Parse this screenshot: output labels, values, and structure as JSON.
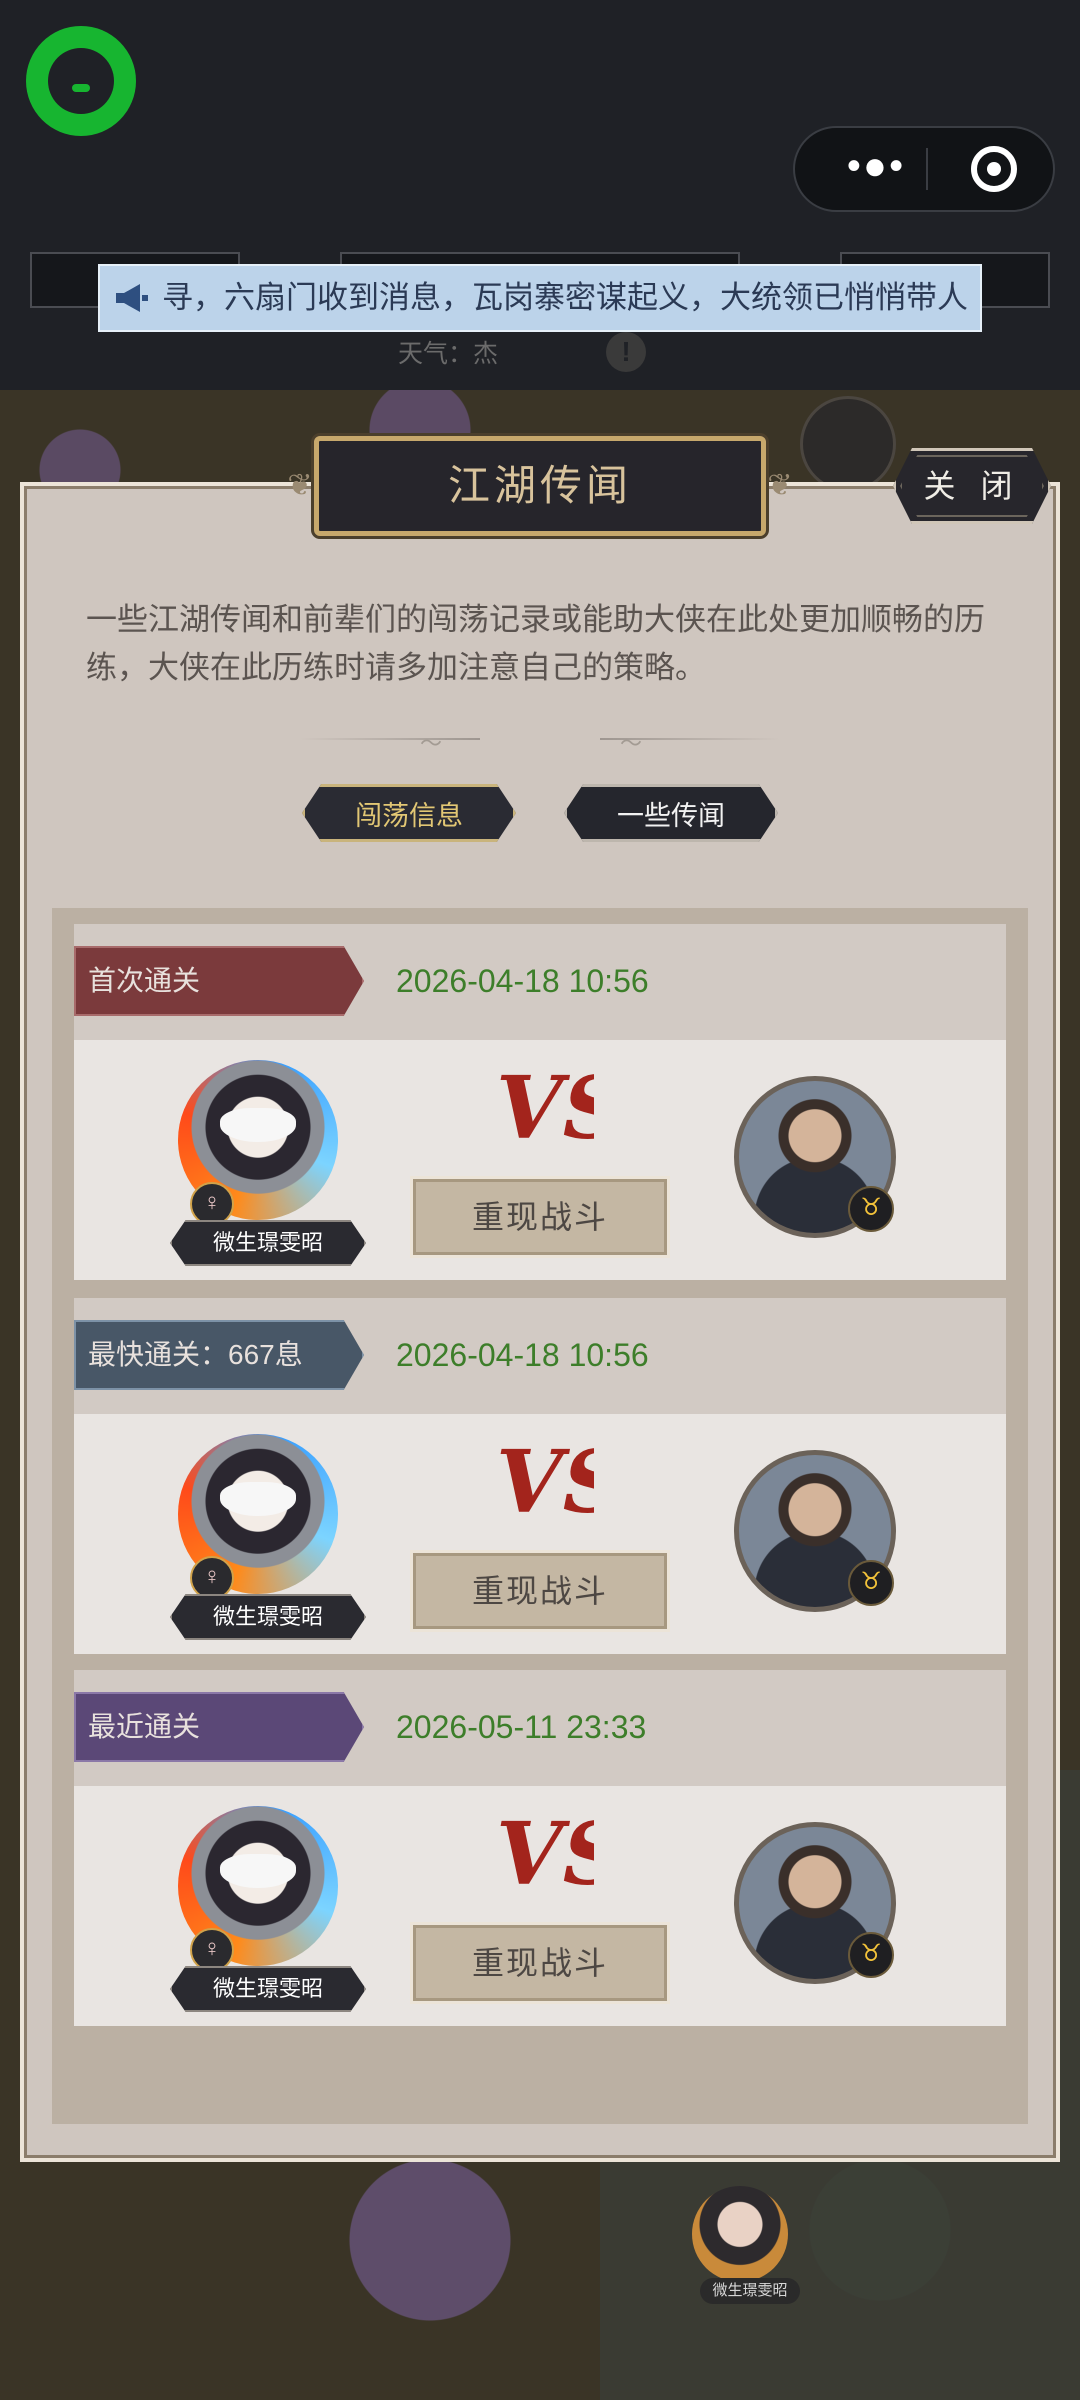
{
  "ticker": {
    "text": "寻，六扇门收到消息，瓦岗寨密谋起义，大统领已悄悄带人"
  },
  "weather": {
    "label": "天气：",
    "value": "杰"
  },
  "panel": {
    "title": "江湖传闻",
    "close_label": "关 闭",
    "description": "一些江湖传闻和前辈们的闯荡记录或能助大侠在此处更加顺畅的历练，大侠在此历练时请多加注意自己的策略。",
    "tabs": [
      {
        "label": "闯荡信息",
        "active": true
      },
      {
        "label": "一些传闻",
        "active": false
      }
    ]
  },
  "records": [
    {
      "badge": "首次通关",
      "badge_color": "#7b3a3c",
      "date": "2026-04-18 10:56",
      "hero_name": "微生璟雯昭",
      "gender_icon": "♀",
      "vs": "VS",
      "replay_label": "重现战斗"
    },
    {
      "badge": "最快通关：667息",
      "badge_color": "#485767",
      "date": "2026-04-18 10:56",
      "hero_name": "微生璟雯昭",
      "gender_icon": "♀",
      "vs": "VS",
      "replay_label": "重现战斗"
    },
    {
      "badge": "最近通关",
      "badge_color": "#5b4877",
      "date": "2026-05-11 23:33",
      "hero_name": "微生璟雯昭",
      "gender_icon": "♀",
      "vs": "VS",
      "replay_label": "重现战斗"
    }
  ],
  "scene": {
    "avatar_name": "微生璟雯昭"
  },
  "icons": {
    "capsule_more": "more-dots-icon",
    "capsule_close": "target-circle-icon",
    "ticker": "megaphone-icon",
    "app": "chat-bubble-logo"
  },
  "colors": {
    "accent_gold": "#c7a86c",
    "date_green": "#3d7e2a"
  }
}
